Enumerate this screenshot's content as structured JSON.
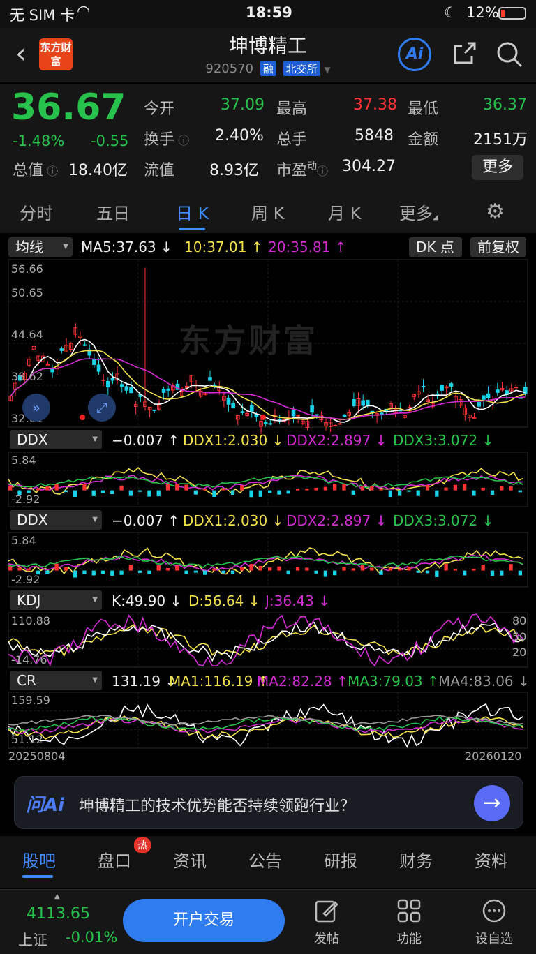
{
  "status_bar": {
    "carrier": "无 SIM 卡",
    "time": "18:59",
    "battery": "12%"
  },
  "header": {
    "title": "坤博精工",
    "code": "920570",
    "tag1": "融",
    "tag2": "北交所",
    "logo": "东方财富",
    "ai": "Ai"
  },
  "quote": {
    "price": "36.67",
    "change_pct": "-1.48%",
    "change": "-0.55",
    "open_label": "今开",
    "open": "37.09",
    "high_label": "最高",
    "high": "37.38",
    "low_label": "最低",
    "low": "36.37",
    "turnover_label": "换手",
    "turnover": "2.40%",
    "volume_label": "总手",
    "volume": "5848",
    "amount_label": "金额",
    "amount": "2151万",
    "mcap_label": "总值",
    "mcap": "18.40亿",
    "float_label": "流值",
    "float": "8.93亿",
    "pe_label": "市盈",
    "pe_sup": "动",
    "pe": "304.27",
    "more": "更多"
  },
  "tabs": [
    "分时",
    "五日",
    "日 K",
    "周 K",
    "月 K",
    "更多"
  ],
  "kline": {
    "selector": "均线",
    "ma5": "MA5:37.63 ↓",
    "ma10": "10:37.01 ↑",
    "ma20": "20:35.81 ↑",
    "dk": "DK 点",
    "adjust": "前复权",
    "watermark": "东方财富",
    "y_ticks": [
      "56.66",
      "50.65",
      "44.64",
      "38.62",
      "32.61"
    ]
  },
  "ddx1": {
    "selector": "DDX",
    "v": "−0.007 ↑",
    "d1": "DDX1:2.030 ↓",
    "d2": "DDX2:2.897 ↓",
    "d3": "DDX3:3.072 ↓",
    "y_top": "5.84",
    "y_bot": "-2.92"
  },
  "ddx2": {
    "selector": "DDX",
    "v": "−0.007 ↑",
    "d1": "DDX1:2.030 ↓",
    "d2": "DDX2:2.897 ↓",
    "d3": "DDX3:3.072 ↓",
    "y_top": "5.84",
    "y_bot": "-2.92"
  },
  "kdj": {
    "selector": "KDJ",
    "k": "K:49.90 ↓",
    "d": "D:56.64 ↓",
    "j": "J:36.43 ↓",
    "y_top": "110.88",
    "y_bot": "-14.76",
    "r80": "80",
    "r50": "50",
    "r20": "20"
  },
  "cr": {
    "selector": "CR",
    "v": "131.19 ↓",
    "ma1": "MA1:116.19 ↑",
    "ma2": "MA2:82.28 ↑",
    "ma3": "MA3:79.03 ↑",
    "ma4": "MA4:83.06 ↓",
    "y_top": "159.59",
    "y_bot": "51.12"
  },
  "dates": {
    "start": "20250804",
    "end": "20260120"
  },
  "ai_bar": {
    "brand": "问Ai",
    "question": "坤博精工的技术优势能否持续领跑行业？"
  },
  "bottom_tabs": [
    "股吧",
    "盘口",
    "资讯",
    "公告",
    "研报",
    "财务",
    "资料"
  ],
  "hot_badge": "热",
  "footer": {
    "index_value": "4113.65",
    "index_name": "上证",
    "index_change": "-0.01%",
    "open_account": "开户交易",
    "post": "发帖",
    "functions": "功能",
    "watchlist": "设自选"
  },
  "colors": {
    "up": "#ff3333",
    "down": "#27c24c",
    "accent": "#3f8cff",
    "ma5": "#ffffff",
    "ma10": "#f2e14b",
    "ma20": "#d22bd2"
  }
}
